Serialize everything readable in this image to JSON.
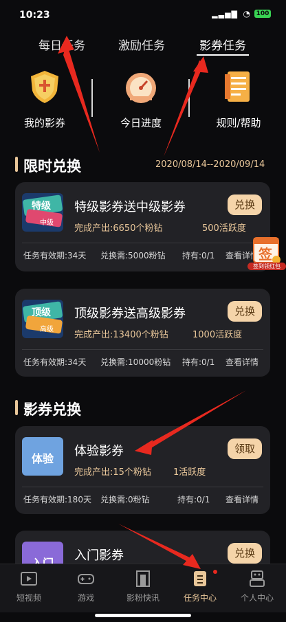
{
  "status_bar": {
    "time": "10:23",
    "battery": "100"
  },
  "tabs": [
    {
      "label": "每日任务"
    },
    {
      "label": "激励任务"
    },
    {
      "label": "影券任务",
      "active": true
    }
  ],
  "shortcuts": [
    {
      "label": "我的影券",
      "icon": "shield-icon"
    },
    {
      "label": "今日进度",
      "icon": "speedometer-icon"
    },
    {
      "label": "规则/帮助",
      "icon": "document-icon"
    }
  ],
  "limited_section": {
    "title": "限时兑换",
    "date_range": "2020/08/14--2020/09/14"
  },
  "limited_cards": [
    {
      "title": "特级影券送中级影券",
      "output": "完成产出:6650个粉钻",
      "activity": "500活跃度",
      "button": "兑换",
      "validity": "任务有效期:34天",
      "cost": "兑换需:5000粉钻",
      "hold": "持有:0/1",
      "detail": "查看详情",
      "thumb_text_top": "特级",
      "thumb_text_bottom": "中级"
    },
    {
      "title": "顶级影券送高级影券",
      "output": "完成产出:13400个粉钻",
      "activity": "1000活跃度",
      "button": "兑换",
      "validity": "任务有效期:34天",
      "cost": "兑换需:10000粉钻",
      "hold": "持有:0/1",
      "detail": "查看详情",
      "thumb_text_top": "顶级",
      "thumb_text_bottom": "高级"
    }
  ],
  "exchange_section": {
    "title": "影券兑换"
  },
  "exchange_cards": [
    {
      "title": "体验影券",
      "output": "完成产出:15个粉钻",
      "activity": "1活跃度",
      "button": "领取",
      "validity": "任务有效期:180天",
      "cost": "兑换需:0粉钻",
      "hold": "持有:0/1",
      "detail": "查看详情",
      "thumb_text_top": "体验"
    },
    {
      "title": "入门影券",
      "button": "兑换",
      "thumb_text_top": "入门"
    }
  ],
  "floating_badge": {
    "glyph": "签",
    "label": "签到领红包"
  },
  "bottom_nav": [
    {
      "label": "短视频",
      "icon": "film-icon"
    },
    {
      "label": "游戏",
      "icon": "gamepad-icon"
    },
    {
      "label": "影粉快讯",
      "icon": "door-icon"
    },
    {
      "label": "任务中心",
      "icon": "task-icon",
      "active": true
    },
    {
      "label": "个人中心",
      "icon": "robot-icon"
    }
  ],
  "colors": {
    "accent": "#e9c79a",
    "button_bg": "#f5d4a9",
    "card_bg": "#222226",
    "arrow": "#e8291f"
  }
}
